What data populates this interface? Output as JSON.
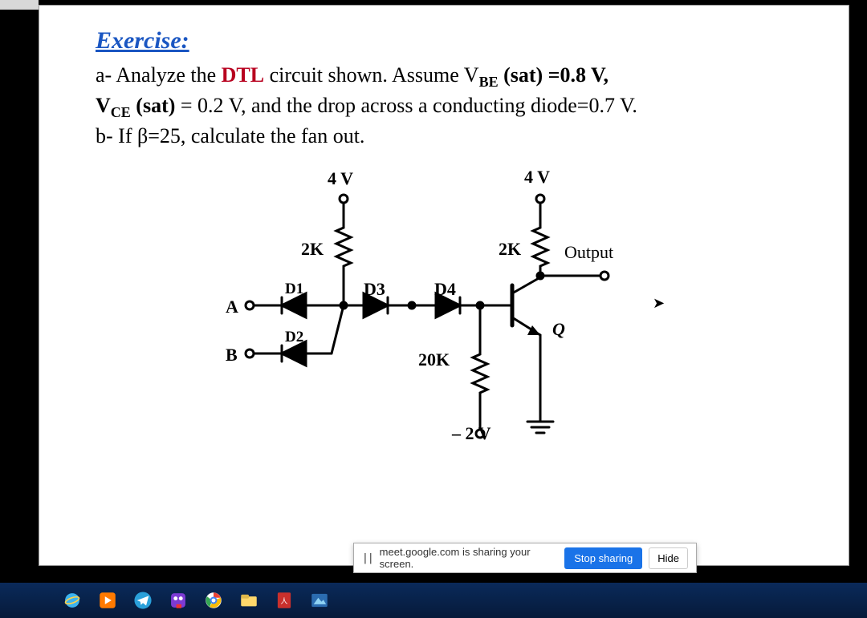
{
  "exercise": {
    "title": "Exercise:",
    "line_a_prefix": "a- Analyze the ",
    "dtl": "DTL",
    "line_a_mid": " circuit shown. Assume V",
    "vbe_sub": "BE",
    "line_a_sat": " (sat) =0.8 V,",
    "line_a2_pre": "V",
    "vce_sub": "CE",
    "line_a2_rest": " (sat) = 0.2 V, and the drop across a conducting diode=0.7 V.",
    "line_b": "b- If β=25, calculate the fan out."
  },
  "circuit": {
    "v_left": "4 V",
    "v_right": "4 V",
    "r_left": "2K",
    "r_right": "2K",
    "output": "Output",
    "d1": "D1",
    "d2": "D2",
    "d3": "D3",
    "d4": "D4",
    "r_bottom": "20K",
    "v_neg": "– 2 V",
    "in_a": "A",
    "in_b": "B",
    "q": "Q"
  },
  "share": {
    "text": "meet.google.com is sharing your screen.",
    "stop": "Stop sharing",
    "hide": "Hide"
  }
}
